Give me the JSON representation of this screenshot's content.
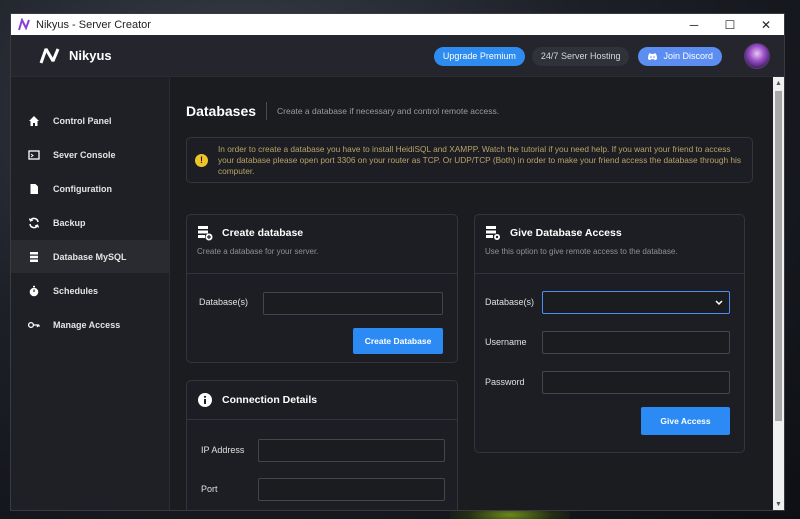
{
  "window": {
    "title": "Nikyus - Server Creator",
    "controls": {
      "minimize": "─",
      "maximize": "☐",
      "close": "✕"
    }
  },
  "topnav": {
    "brand": "Nikyus",
    "upgrade_label": "Upgrade Premium",
    "hosting_label": "24/7 Server Hosting",
    "discord_label": "Join Discord"
  },
  "sidebar": {
    "items": [
      {
        "label": "Control Panel",
        "icon": "home-icon"
      },
      {
        "label": "Sever Console",
        "icon": "console-icon"
      },
      {
        "label": "Configuration",
        "icon": "file-icon"
      },
      {
        "label": "Backup",
        "icon": "sync-icon"
      },
      {
        "label": "Database MySQL",
        "icon": "database-icon"
      },
      {
        "label": "Schedules",
        "icon": "stopwatch-icon"
      },
      {
        "label": "Manage Access",
        "icon": "key-icon"
      }
    ],
    "active_index": 4
  },
  "page": {
    "title": "Databases",
    "subtitle": "Create a database if necessary and control remote access."
  },
  "alert": {
    "text": "In order to create a database you have to install HeidiSQL and XAMPP. Watch the tutorial if you need help. If you want your friend to access your database please open port 3306 on your router as TCP. Or UDP/TCP (Both) in order to make your friend access the database through his computer."
  },
  "create_db": {
    "title": "Create database",
    "subtitle": "Create a database for your server.",
    "field_label": "Database(s)",
    "field_value": "",
    "button_label": "Create Database"
  },
  "give_access": {
    "title": "Give Database Access",
    "subtitle": "Use this option to give remote access to the database.",
    "database_label": "Database(s)",
    "database_value": "",
    "username_label": "Username",
    "username_value": "",
    "password_label": "Password",
    "password_value": "",
    "button_label": "Give Access"
  },
  "connection": {
    "title": "Connection Details",
    "ip_label": "IP Address",
    "ip_value": "",
    "port_label": "Port",
    "port_value": ""
  },
  "colors": {
    "accent": "#2b8af3",
    "discord": "#5b8ef0",
    "warning": "#f0c428"
  }
}
